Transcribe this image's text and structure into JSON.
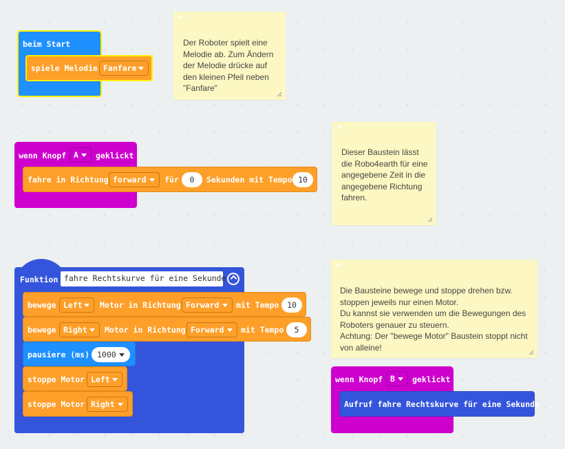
{
  "colors": {
    "background": "#ecf0f1",
    "basic": "#1e90ff",
    "music": "#fd9f29",
    "input": "#cd00cd",
    "functions": "#3455db",
    "note": "#fdf8c3"
  },
  "start_block": {
    "label": "beim Start",
    "melody_label": "spiele Melodie",
    "melody_value": "Fanfare"
  },
  "button_a_block": {
    "prefix": "wenn Knopf",
    "button": "A",
    "suffix": "geklickt",
    "drive_label": "fahre in Richtung",
    "direction": "forward",
    "for_label": "für",
    "seconds": "0",
    "seconds_label": "Sekunden mit Tempo",
    "speed": "10"
  },
  "function_block": {
    "label": "Funktion",
    "name": "fahre Rechtskurve für eine Sekunde",
    "move1": {
      "label": "bewege",
      "motor": "Left",
      "dir_label": "Motor in Richtung",
      "direction": "Forward",
      "speed_label": "mit Tempo",
      "speed": "10"
    },
    "move2": {
      "label": "bewege",
      "motor": "Right",
      "dir_label": "Motor in Richtung",
      "direction": "Forward",
      "speed_label": "mit Tempo",
      "speed": "5"
    },
    "pause": {
      "label": "pausiere (ms)",
      "value": "1000"
    },
    "stop1": {
      "label": "stoppe Motor",
      "motor": "Left"
    },
    "stop2": {
      "label": "stoppe Motor",
      "motor": "Right"
    }
  },
  "button_b_block": {
    "prefix": "wenn Knopf",
    "button": "B",
    "suffix": "geklickt",
    "call_label": "Aufruf fahre Rechtskurve für eine Sekunde"
  },
  "notes": {
    "note1": "Der Roboter spielt eine\nMelodie ab. Zum Ändern\nder Melodie drücke auf\nden kleinen Pfeil neben\n\"Fanfare\"",
    "note2": "Dieser Baustein lässt\ndie Robo4earth für eine\nangegebene Zeit in die\nangegebene Richtung\nfahren.",
    "note3": "Die Bausteine bewege und stoppe drehen bzw.\nstoppen jeweils nur einen Motor.\nDu kannst sie verwenden um die Bewegungen des\nRoboters genauer zu steuern.\nAchtung: Der \"bewege Motor\" Baustein stoppt nicht\nvon alleine!"
  }
}
